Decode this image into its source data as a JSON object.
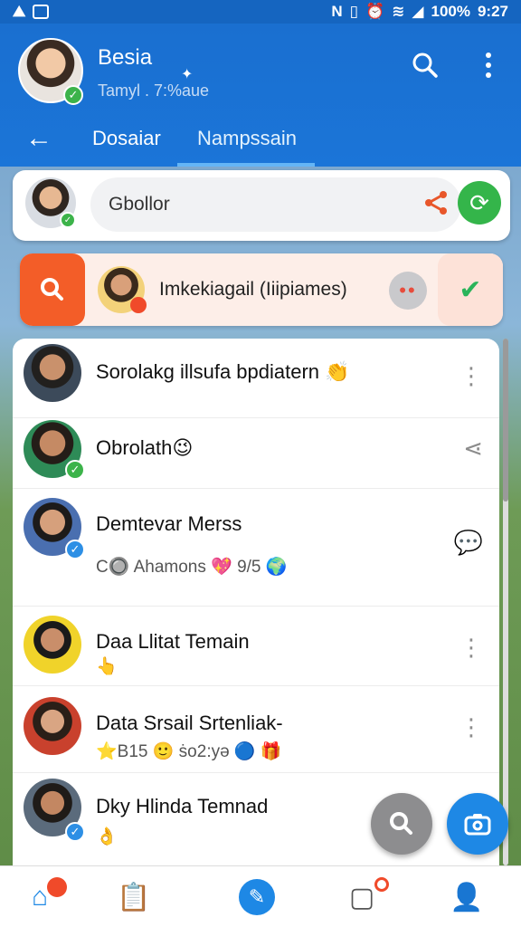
{
  "status_bar": {
    "battery": "100%",
    "time": "9:27"
  },
  "header": {
    "title": "Besia",
    "subtitle": "Tamyl . 7:%aue",
    "tabs": [
      {
        "label": "Dosaiar",
        "active": false
      },
      {
        "label": "Nampssain",
        "active": true
      }
    ]
  },
  "search_card": {
    "input_value": "Gbollor"
  },
  "filter_card": {
    "label": "Imkekiagail (Iiipiames)"
  },
  "chats": [
    {
      "name": "Sorolakg illsufa bpdiatern 👏",
      "sub": "",
      "action": "more-vertical"
    },
    {
      "name": "Obrolath😉",
      "sub": "",
      "action": "share"
    },
    {
      "name": "Demtevar Merss",
      "sub": "C🔘 Ahamons 💖 9/5 🌍",
      "action": "chat"
    },
    {
      "name": "Daa Llitat Temain",
      "sub": "👆",
      "action": "more-vertical"
    },
    {
      "name": "Data Srsail Srtenliak-",
      "sub": "⭐B15 🙂 ṡo2:yə 🔵 🎁",
      "action": "more-vertical"
    },
    {
      "name": "Dky Hlinda Temnad",
      "sub": "👌",
      "action": ""
    }
  ],
  "colors": {
    "primary": "#1b75d8",
    "accent_orange": "#f35d28",
    "accent_green": "#34b54a",
    "fab_blue": "#1e88e5"
  }
}
